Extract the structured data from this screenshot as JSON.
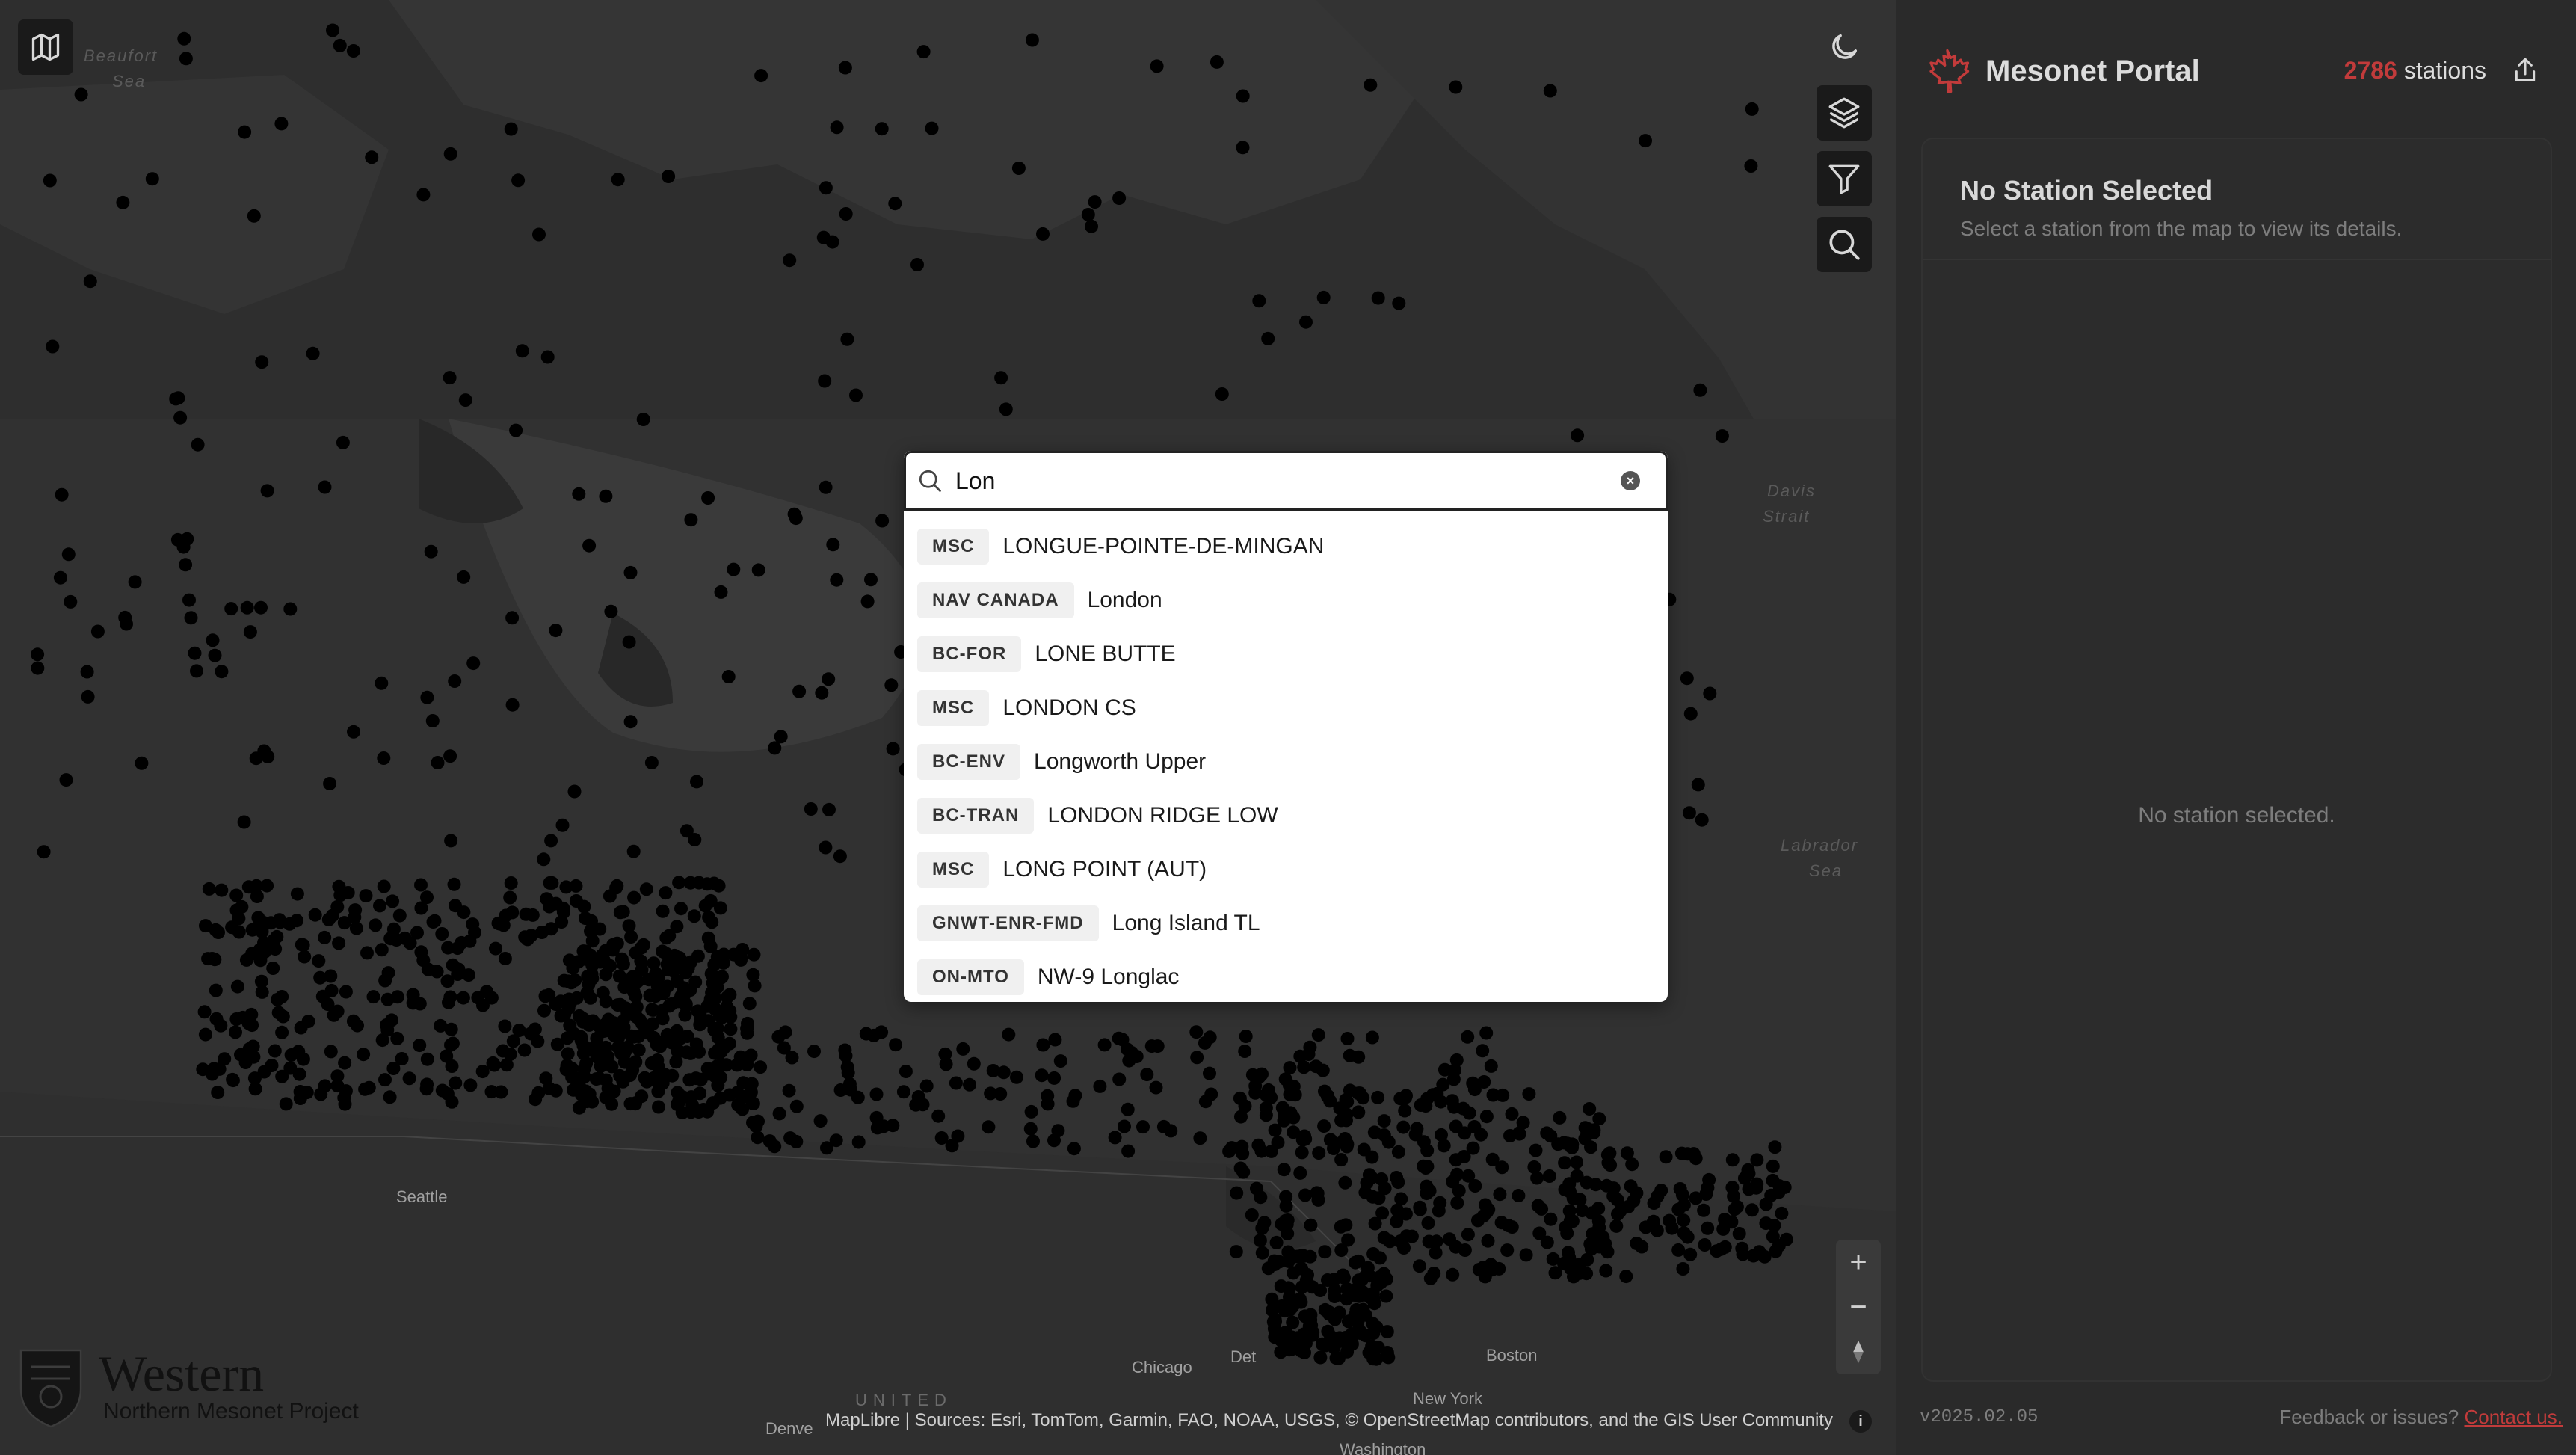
{
  "map": {
    "labels": {
      "beaufort": "Beaufort",
      "beaufort_sea": "Sea",
      "davis": "Davis",
      "davis_strait": "Strait",
      "labrador": "Labrador",
      "labrador_sea": "Sea",
      "seattle": "Seattle",
      "chicago": "Chicago",
      "boston": "Boston",
      "new_york": "New York",
      "denver": "Denve",
      "washington": "Washington",
      "united": "UNITED",
      "detroit": "Det"
    },
    "attribution": "MapLibre | Sources: Esri, TomTom, Garmin, FAO, NOAA, USGS, © OpenStreetMap contributors, and the GIS User Community",
    "zoom_in": "+",
    "zoom_out": "−",
    "info": "i"
  },
  "logo": {
    "name": "Western",
    "project": "Northern Mesonet Project"
  },
  "search": {
    "query": "Lon",
    "clear": "×",
    "results": [
      {
        "tag": "MSC",
        "name": "LONGUE-POINTE-DE-MINGAN"
      },
      {
        "tag": "NAV CANADA",
        "name": "London"
      },
      {
        "tag": "BC-FOR",
        "name": "LONE BUTTE"
      },
      {
        "tag": "MSC",
        "name": "LONDON CS"
      },
      {
        "tag": "BC-ENV",
        "name": "Longworth Upper"
      },
      {
        "tag": "BC-TRAN",
        "name": "LONDON RIDGE LOW"
      },
      {
        "tag": "MSC",
        "name": "LONG POINT (AUT)"
      },
      {
        "tag": "GNWT-ENR-FMD",
        "name": "Long Island TL"
      },
      {
        "tag": "ON-MTO",
        "name": "NW-9 Longlac"
      }
    ]
  },
  "panel": {
    "title": "Mesonet Portal",
    "station_count": "2786",
    "stations_label": "stations",
    "card_title": "No Station Selected",
    "card_subtitle": "Select a station from the map to view its details.",
    "empty_text": "No station selected.",
    "version": "v2025.02.05",
    "feedback_text": "Feedback or issues?",
    "contact_link": "Contact us."
  },
  "colors": {
    "accent": "#c23b3b",
    "map_bg": "#2e2e2e",
    "land": "#353535",
    "water": "#262626",
    "station": "#000000"
  }
}
